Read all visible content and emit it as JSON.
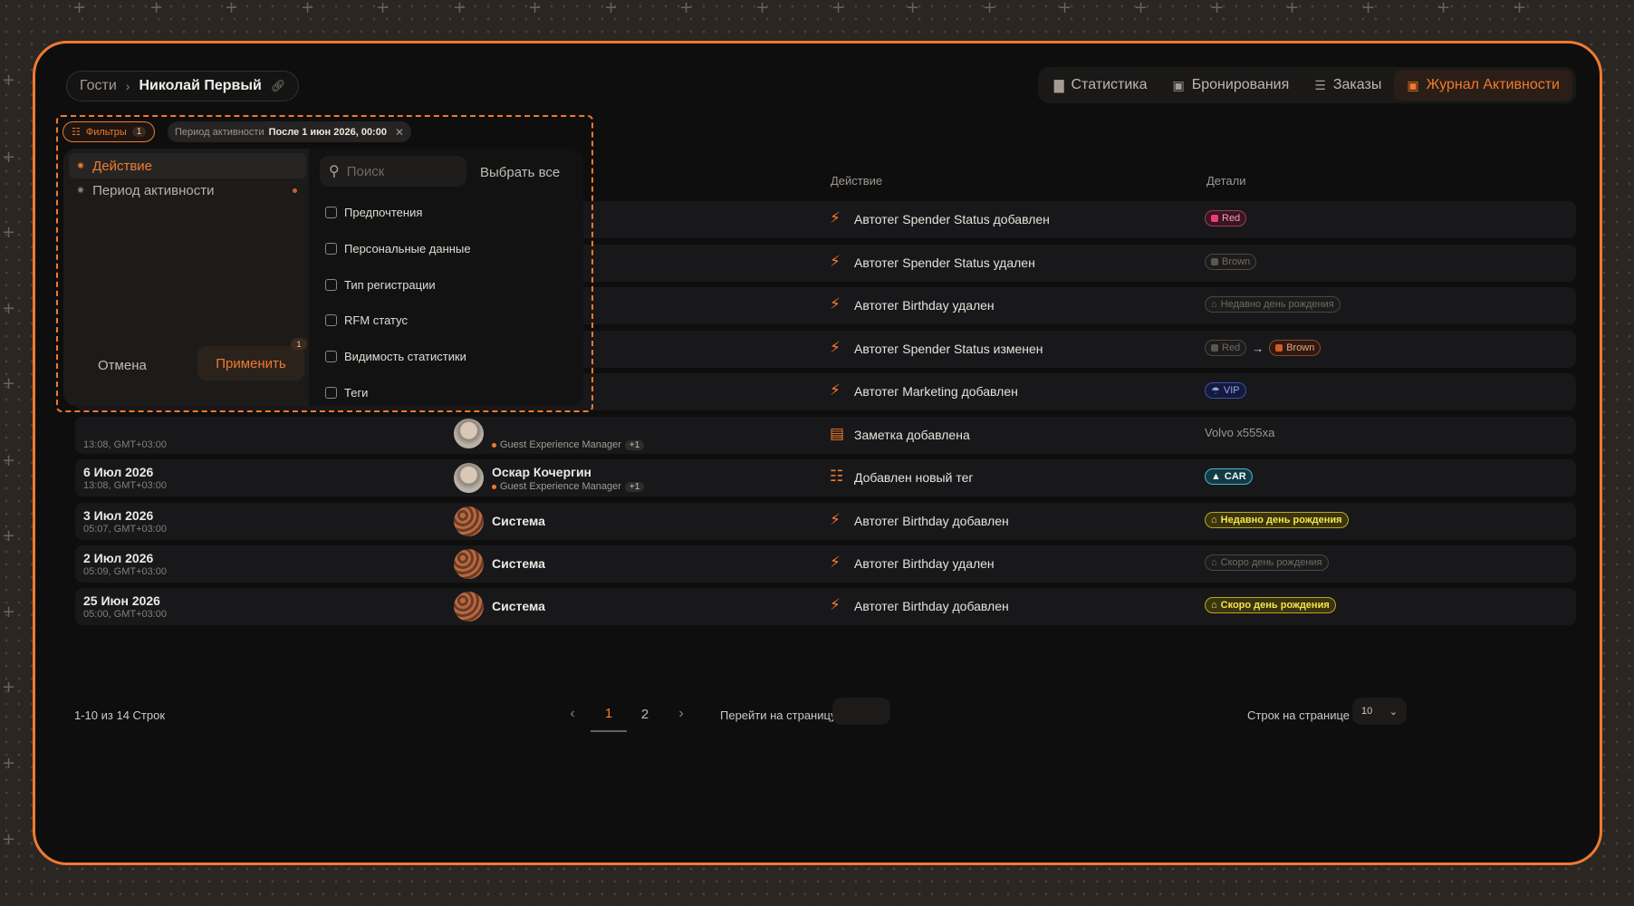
{
  "breadcrumb": {
    "parent": "Гости",
    "current": "Николай Первый"
  },
  "tabs": [
    {
      "label": "Статистика",
      "icon": "bar-chart-icon"
    },
    {
      "label": "Бронирования",
      "icon": "calendar-icon"
    },
    {
      "label": "Заказы",
      "icon": "list-icon"
    },
    {
      "label": "Журнал Активности",
      "icon": "calendar-activity-icon",
      "active": true
    }
  ],
  "table": {
    "headers": {
      "action": "Действие",
      "details": "Детали"
    },
    "rows": [
      {
        "date": "",
        "time": "",
        "who": "",
        "role": "",
        "more": "",
        "action": "Автотег Spender Status добавлен",
        "icon": "bolt-icon"
      },
      {
        "date": "",
        "time": "",
        "who": "",
        "role": "",
        "more": "",
        "action": "Автотег Spender Status удален",
        "icon": "bolt-icon"
      },
      {
        "date": "",
        "time": "",
        "who": "",
        "role": "",
        "more": "",
        "action": "Автотег Birthday удален",
        "icon": "bolt-icon"
      },
      {
        "date": "",
        "time": "",
        "who": "",
        "role": "",
        "more": "",
        "action": "Автотег Spender Status изменен",
        "icon": "bolt-icon"
      },
      {
        "date": "",
        "time": "",
        "who": "",
        "role": "",
        "more": "",
        "action": "Автотег Marketing добавлен",
        "icon": "bolt-icon"
      },
      {
        "date": "",
        "time": "13:08, GMT+03:00",
        "who": "",
        "role": "Guest Experience Manager",
        "more": "+1",
        "action": "Заметка добавлена",
        "icon": "note-icon",
        "detail_text": "Volvo x555xa"
      },
      {
        "date": "6 Июл 2026",
        "time": "13:08, GMT+03:00",
        "who": "Оскар Кочергин",
        "role": "Guest Experience Manager",
        "more": "+1",
        "action": "Добавлен новый тег",
        "icon": "tag-add-icon"
      },
      {
        "date": "3 Июл 2026",
        "time": "05:07, GMT+03:00",
        "who": "Система",
        "role": "",
        "more": "",
        "action": "Автотег Birthday добавлен",
        "icon": "bolt-icon"
      },
      {
        "date": "2 Июл 2026",
        "time": "05:09, GMT+03:00",
        "who": "Система",
        "role": "",
        "more": "",
        "action": "Автотег Birthday удален",
        "icon": "bolt-icon"
      },
      {
        "date": "25 Июн 2026",
        "time": "05:00, GMT+03:00",
        "who": "Система",
        "role": "",
        "more": "",
        "action": "Автотег Birthday добавлен",
        "icon": "bolt-icon"
      }
    ],
    "badges": {
      "r0": "Red",
      "r1": "Brown",
      "r2": "Недавно день рождения",
      "r3a": "Red",
      "r3b": "Brown",
      "r4": "VIP",
      "r6": "CAR",
      "r7": "Недавно день рождения",
      "r8": "Скоро день рождения",
      "r9": "Скоро день рождения"
    },
    "arrow": "→"
  },
  "filters": {
    "chip_label": "Фильтры",
    "chip_count": "1",
    "period_label": "Период активности",
    "period_value": "После 1 июн 2026, 00:00",
    "categories": [
      "Действие",
      "Период активности"
    ],
    "search_placeholder": "Поиск",
    "select_all": "Выбрать все",
    "options": [
      "Предпочтения",
      "Персональные данные",
      "Тип регистрации",
      "RFM статус",
      "Видимость статистики",
      "Теги"
    ],
    "cancel": "Отмена",
    "apply": "Применить",
    "apply_count": "1"
  },
  "footer": {
    "count": "1-10 из 14 Строк",
    "pages": [
      "1",
      "2"
    ],
    "goto_label": "Перейти на страницу",
    "rows_per_page_label": "Строк на странице",
    "rows_per_page_value": "10"
  },
  "colors": {
    "accent": "#f07a2e",
    "background": "#0e0e0f"
  }
}
